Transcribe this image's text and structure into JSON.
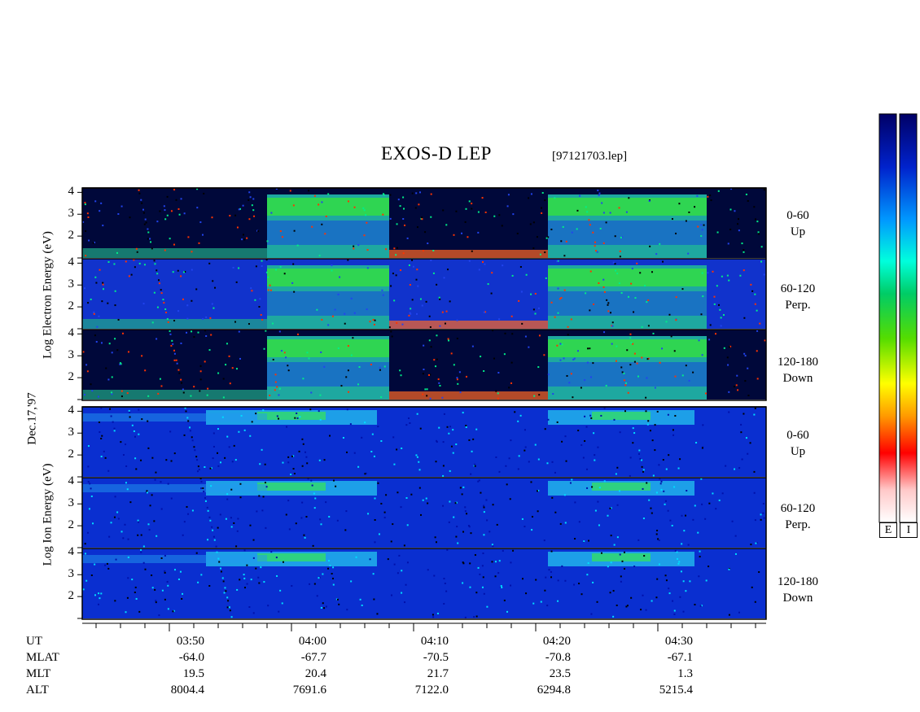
{
  "header": {
    "title": "EXOS-D LEP",
    "file": "[97121703.lep]"
  },
  "left_axis": {
    "electron_label": "Log   Electron   Energy  (eV)",
    "ion_label": "Log   Ion   Energy  (eV)",
    "date_label": "Dec.17,'97"
  },
  "panels": [
    {
      "species": "electron",
      "angle": "0-60",
      "dir": "Up"
    },
    {
      "species": "electron",
      "angle": "60-120",
      "dir": "Perp."
    },
    {
      "species": "electron",
      "angle": "120-180",
      "dir": "Down"
    },
    {
      "species": "ion",
      "angle": "0-60",
      "dir": "Up"
    },
    {
      "species": "ion",
      "angle": "60-120",
      "dir": "Perp."
    },
    {
      "species": "ion",
      "angle": "120-180",
      "dir": "Down"
    }
  ],
  "y_ticks": [
    "4",
    "3",
    "2"
  ],
  "colorbar": {
    "labels": [
      "E",
      "I"
    ],
    "colors": [
      "#ffffff",
      "#ffc8c8",
      "#ff0000",
      "#ff9900",
      "#ffff00",
      "#00cc00",
      "#00ffcc",
      "#0088ff",
      "#0000cc",
      "#000066"
    ]
  },
  "ephemeris": {
    "row_labels": [
      "UT",
      "MLAT",
      "MLT",
      "ALT"
    ],
    "columns": [
      {
        "UT": "03:50",
        "MLAT": "-64.0",
        "MLT": "19.5",
        "ALT": "8004.4"
      },
      {
        "UT": "04:00",
        "MLAT": "-67.7",
        "MLT": "20.4",
        "ALT": "7691.6"
      },
      {
        "UT": "04:10",
        "MLAT": "-70.5",
        "MLT": "21.7",
        "ALT": "7122.0"
      },
      {
        "UT": "04:20",
        "MLAT": "-70.8",
        "MLT": "23.5",
        "ALT": "6294.8"
      },
      {
        "UT": "04:30",
        "MLAT": "-67.1",
        "MLT": "1.3",
        "ALT": "5215.4"
      }
    ]
  },
  "chart_data": {
    "type": "heatmap",
    "title": "EXOS-D LEP",
    "x_label": "UT",
    "x_ticks": [
      "03:50",
      "04:00",
      "04:10",
      "04:20",
      "04:30"
    ],
    "y_label_electron": "Log Electron Energy (eV)",
    "y_label_ion": "Log Ion Energy (eV)",
    "y_range_log_eV": [
      1,
      4.2
    ],
    "date": "Dec.17,'97",
    "electron_active_intervals_UT": [
      [
        "03:58",
        "04:08"
      ],
      [
        "04:21",
        "04:34"
      ]
    ],
    "ion_active_intervals_UT": [
      [
        "03:53",
        "04:07"
      ],
      [
        "04:21",
        "04:33"
      ]
    ]
  }
}
